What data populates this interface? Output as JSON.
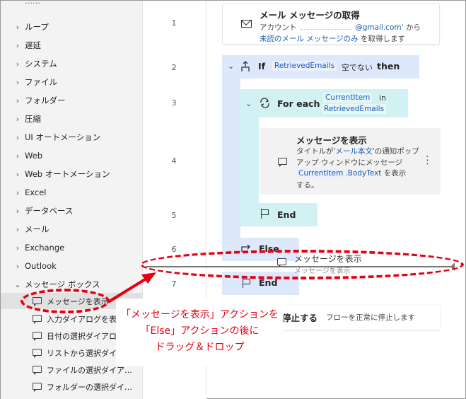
{
  "sidebar": {
    "top_partial": "……",
    "items": [
      {
        "label": "ループ"
      },
      {
        "label": "遅延"
      },
      {
        "label": "システム"
      },
      {
        "label": "ファイル"
      },
      {
        "label": "フォルダー"
      },
      {
        "label": "圧縮"
      },
      {
        "label": "UI オートメーション"
      },
      {
        "label": "Web"
      },
      {
        "label": "Web オートメーション"
      },
      {
        "label": "Excel"
      },
      {
        "label": "データベース"
      },
      {
        "label": "メール"
      },
      {
        "label": "Exchange"
      },
      {
        "label": "Outlook"
      },
      {
        "label": "メッセージ ボックス"
      }
    ],
    "subitems": [
      {
        "label": "メッセージを表示"
      },
      {
        "label": "入力ダイアログを表示"
      },
      {
        "label": "日付の選択ダイアロ…"
      },
      {
        "label": "リストから選択ダイア…"
      },
      {
        "label": "ファイルの選択ダイア…"
      },
      {
        "label": "フォルダーの選択ダイ…"
      }
    ]
  },
  "line_numbers": [
    "1",
    "2",
    "3",
    "4",
    "5",
    "6",
    "7"
  ],
  "flow": {
    "step1": {
      "title": "メール メッセージの取得",
      "line1_prefix": "アカウント",
      "line1_account": "@gmail.com'",
      "line1_suffix": "から",
      "line2_link": "未読のメール メッセージのみ",
      "line2_suffix": "を取得します"
    },
    "if_block": {
      "label": "If",
      "variable": "RetrievedEmails",
      "condition": "空でない",
      "then": "then"
    },
    "foreach_block": {
      "label": "For each",
      "variable": "CurrentItem",
      "in_word": "in",
      "collection": "RetrievedEmails"
    },
    "message_card": {
      "title": "メッセージを表示",
      "desc_prefix": "タイトルが",
      "desc_title_var": "'メール本文'",
      "desc_mid": "の通知ポップ",
      "desc_line2": "アップ ウィンドウにメッセージ",
      "desc_var": "CurrentItem",
      "desc_var2": ".BodyText",
      "desc_suffix": "を表示",
      "desc_end": "する。",
      "more_icon": "⋮"
    },
    "foreach_end": "End",
    "else_label": "Else",
    "end_label": "End",
    "stop_card": {
      "title": "停止する",
      "desc": "フローを正常に停止します"
    }
  },
  "drag_ghost": {
    "title": "メッセージを表示",
    "subtitle": "メッセージを表示"
  },
  "callout": {
    "line1": "「メッセージを表示」アクションを",
    "line2": "「Else」アクションの後に",
    "line3": "ドラッグ＆ドロップ"
  },
  "colors": {
    "annotation_red": "#e60012",
    "if_block_bg": "#dde8fb",
    "foreach_block_bg": "#d2f1f3",
    "variable_blue": "#1a5bb5"
  }
}
